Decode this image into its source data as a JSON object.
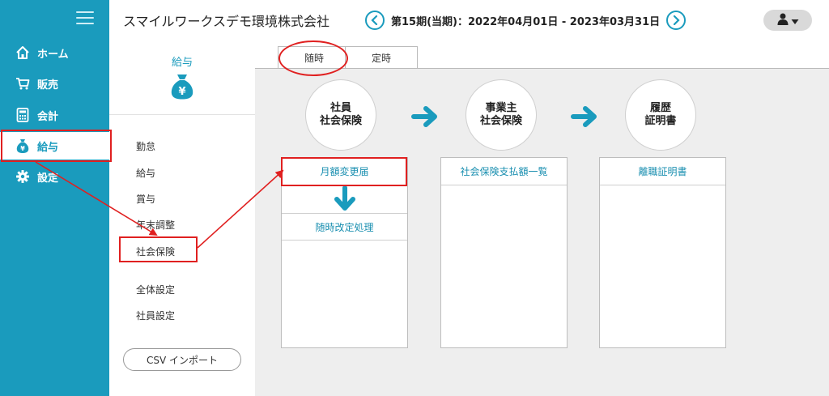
{
  "nav": {
    "items": [
      {
        "label": "ホーム",
        "icon": "home-icon"
      },
      {
        "label": "販売",
        "icon": "cart-icon"
      },
      {
        "label": "会計",
        "icon": "calculator-icon"
      },
      {
        "label": "給与",
        "icon": "money-bag-icon"
      },
      {
        "label": "設定",
        "icon": "gear-icon"
      }
    ],
    "active": "給与"
  },
  "header": {
    "company": "スマイルワークスデモ環境株式会社",
    "period": "第15期(当期)：2022年04月01日 - 2023年03月31日"
  },
  "subnav": {
    "title": "給与",
    "items": [
      "勤怠",
      "給与",
      "賞与",
      "年末調整",
      "社会保険",
      "全体設定",
      "社員設定"
    ],
    "csv_button": "CSV インポート"
  },
  "tabs": [
    {
      "label": "随時",
      "active": true
    },
    {
      "label": "定時",
      "active": false
    }
  ],
  "steps": [
    {
      "line1": "社員",
      "line2": "社会保険"
    },
    {
      "line1": "事業主",
      "line2": "社会保険"
    },
    {
      "line1": "履歴",
      "line2": "証明書"
    }
  ],
  "panels": {
    "employee": {
      "row1": "月額変更届",
      "row2": "随時改定処理"
    },
    "employer": {
      "row1": "社会保険支払額一覧"
    },
    "history": {
      "row1": "離職証明書"
    }
  },
  "colors": {
    "accent": "#1a9bbd",
    "annotation": "#e02020",
    "background_gray": "#eeeeee"
  }
}
